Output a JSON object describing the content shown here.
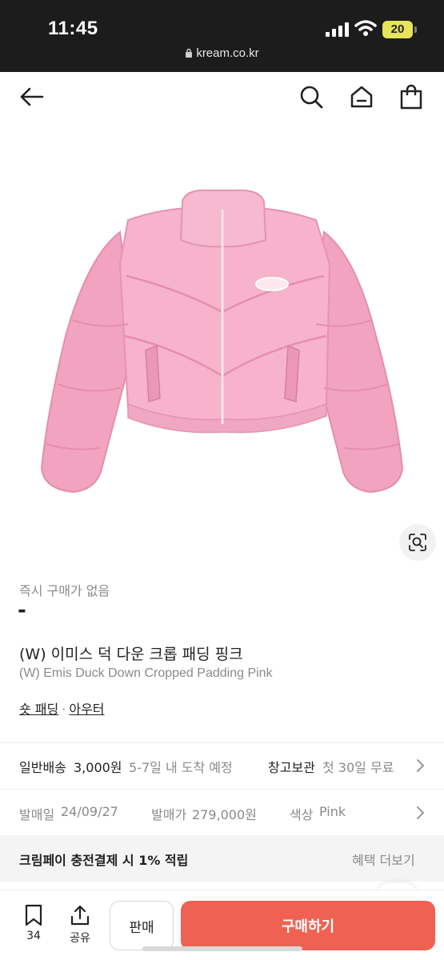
{
  "status_bar": {
    "time": "11:45",
    "battery": "20",
    "url": "kream.co.kr",
    "icons": [
      "signal-icon",
      "wifi-icon",
      "battery-icon",
      "lock-icon"
    ]
  },
  "nav": {
    "icons": [
      "back-arrow-icon",
      "search-icon",
      "home-icon",
      "shopping-bag-icon"
    ]
  },
  "product": {
    "image_alt": "pink cropped puffer jacket",
    "instant_label": "즉시 구매가 없음",
    "price": "-",
    "name_ko": "(W) 이미스 덕 다운 크롭 패딩 핑크",
    "name_en": "(W) Emis Duck Down Cropped Padding Pink",
    "category_1": "숏 패딩",
    "category_separator": "·",
    "category_2": "아우터"
  },
  "shipping": {
    "general_label": "일반배송",
    "general_price": "3,000원",
    "general_eta": "5-7일 내 도착 예정",
    "storage_label": "창고보관",
    "storage_offer": "첫 30일 무료"
  },
  "details": {
    "release_label": "발매일",
    "release_value": "24/09/27",
    "price_label": "발매가",
    "price_value": "279,000원",
    "color_label": "색상",
    "color_value": "Pink"
  },
  "kream_pay": {
    "text": "크림페이 충전결제 시 1% 적립",
    "more": "혜택 더보기"
  },
  "bottom_bar": {
    "bookmark_count": "34",
    "share_label": "공유",
    "sell_label": "판매",
    "buy_label": "구매하기"
  },
  "colors": {
    "buy_button": "#ef6253",
    "jacket_pink": "#f4a9c4"
  }
}
